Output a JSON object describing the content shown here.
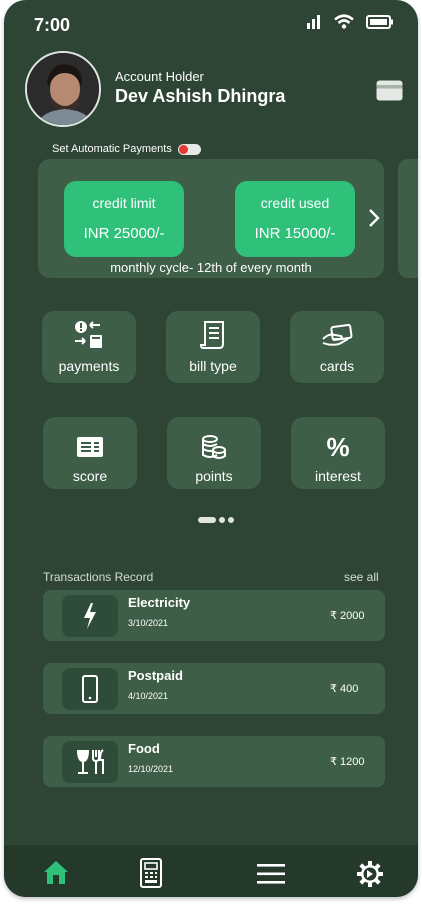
{
  "status_bar": {
    "time": "7:00"
  },
  "profile": {
    "account_label": "Account Holder",
    "name": "Dev Ashish Dhingra"
  },
  "autopay": {
    "label": "Set Automatic Payments",
    "enabled": false
  },
  "credit": {
    "limit_label": "credit limit",
    "limit_value": "INR 25000/-",
    "used_label": "credit used",
    "used_value": "INR 15000/-",
    "cycle": "monthly cycle- 12th of every month"
  },
  "tiles": [
    {
      "label": "payments",
      "icon": "payments-icon"
    },
    {
      "label": "bill type",
      "icon": "bill-icon"
    },
    {
      "label": "cards",
      "icon": "cards-icon"
    },
    {
      "label": "score",
      "icon": "score-icon"
    },
    {
      "label": "points",
      "icon": "coins-icon"
    },
    {
      "label": "interest",
      "icon": "percent-icon"
    }
  ],
  "transactions": {
    "title": "Transactions Record",
    "see_all": "see all",
    "items": [
      {
        "name": "Electricity",
        "date": "3/10/2021",
        "amount": "₹ 2000",
        "icon": "lightning-icon"
      },
      {
        "name": "Postpaid",
        "date": "4/10/2021",
        "amount": "₹ 400",
        "icon": "phone-icon"
      },
      {
        "name": "Food",
        "date": "12/10/2021",
        "amount": "₹ 1200",
        "icon": "food-icon"
      }
    ]
  },
  "nav": [
    "home-icon",
    "pos-terminal-icon",
    "menu-icon",
    "settings-icon"
  ],
  "colors": {
    "background": "#2e4434",
    "card": "#3e5e48",
    "accent": "#2fc07a",
    "nav_bar": "#25392b",
    "toggle_red": "#e53935"
  }
}
